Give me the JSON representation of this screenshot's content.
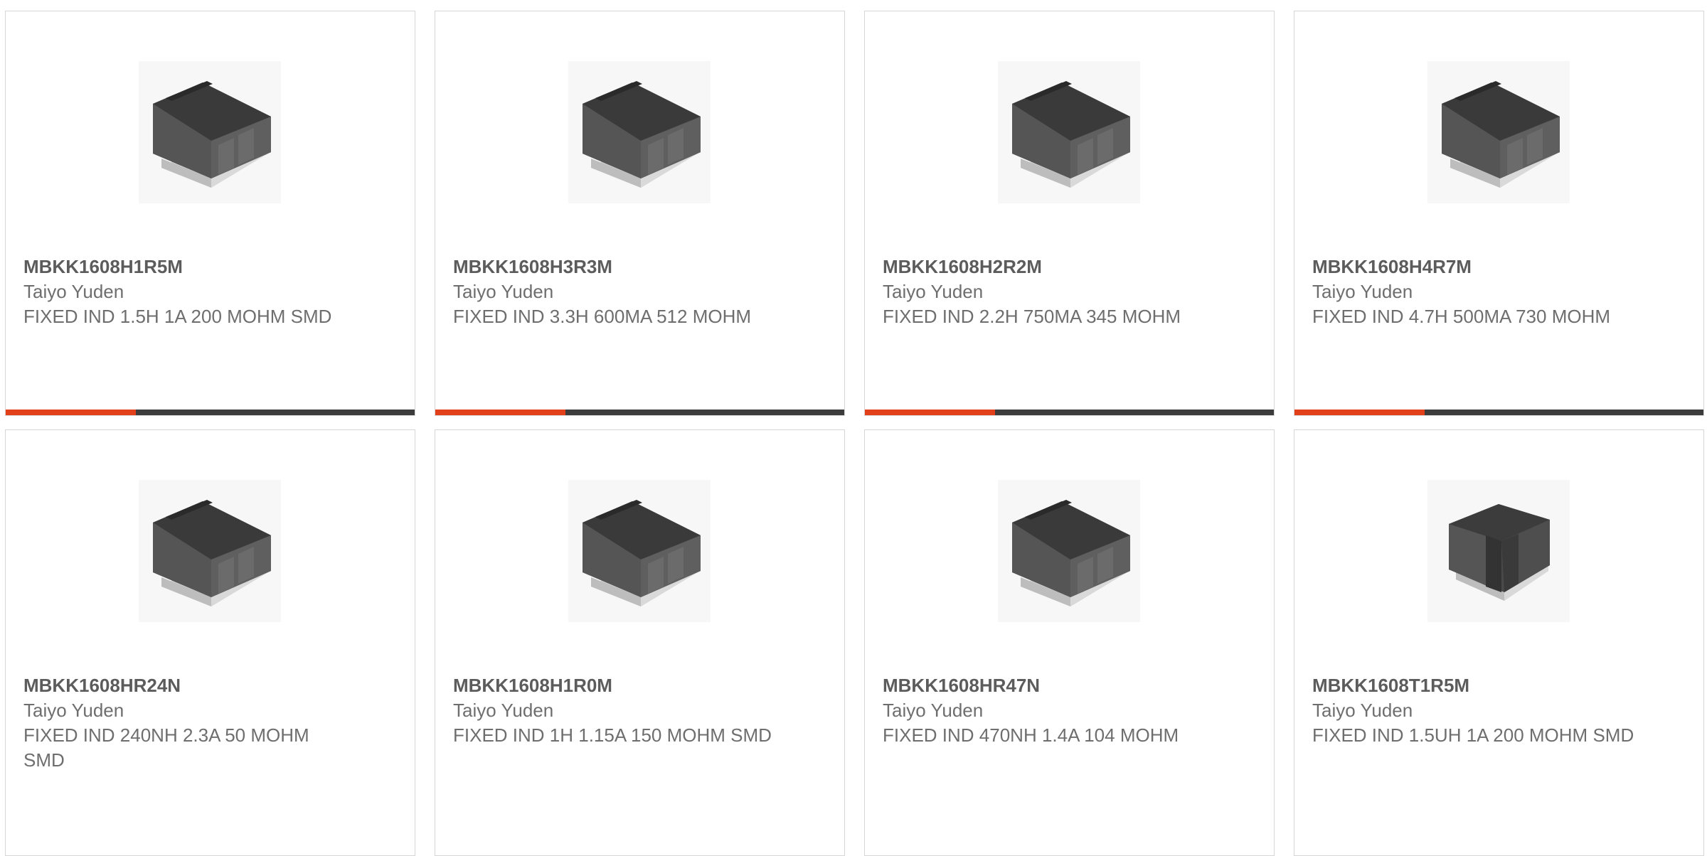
{
  "theme": {
    "accent": "#e1401a",
    "bar": "#3c3c3c",
    "border": "#d6d6d6",
    "text": "#6a6a6a"
  },
  "products": [
    {
      "part": "MBKK1608H1R5M",
      "manufacturer": "Taiyo Yuden",
      "description": "FIXED IND 1.5H 1A 200 MOHM SMD",
      "image": "inductor-icon"
    },
    {
      "part": "MBKK1608H3R3M",
      "manufacturer": "Taiyo Yuden",
      "description": "FIXED IND 3.3H 600MA 512 MOHM",
      "image": "inductor-icon"
    },
    {
      "part": "MBKK1608H2R2M",
      "manufacturer": "Taiyo Yuden",
      "description": "FIXED IND 2.2H 750MA 345 MOHM",
      "image": "inductor-icon"
    },
    {
      "part": "MBKK1608H4R7M",
      "manufacturer": "Taiyo Yuden",
      "description": "FIXED IND 4.7H 500MA 730 MOHM",
      "image": "inductor-icon"
    },
    {
      "part": "MBKK1608HR24N",
      "manufacturer": "Taiyo Yuden",
      "description": "FIXED IND 240NH 2.3A 50 MOHM SMD",
      "image": "inductor-icon"
    },
    {
      "part": "MBKK1608H1R0M",
      "manufacturer": "Taiyo Yuden",
      "description": "FIXED IND 1H 1.15A 150 MOHM SMD",
      "image": "inductor-icon"
    },
    {
      "part": "MBKK1608HR47N",
      "manufacturer": "Taiyo Yuden",
      "description": "FIXED IND 470NH 1.4A 104 MOHM",
      "image": "inductor-icon"
    },
    {
      "part": "MBKK1608T1R5M",
      "manufacturer": "Taiyo Yuden",
      "description": "FIXED IND 1.5UH 1A 200 MOHM SMD",
      "image": "inductor-icon"
    }
  ]
}
